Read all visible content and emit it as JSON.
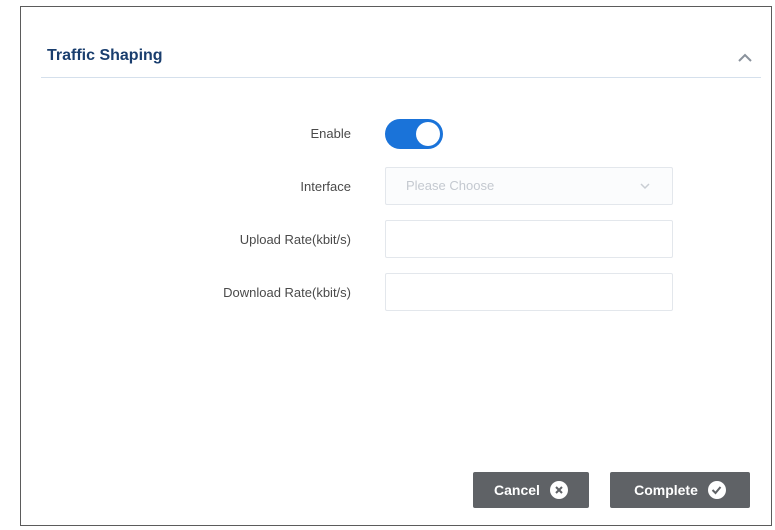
{
  "section": {
    "title": "Traffic Shaping",
    "collapse_icon": "chevron-up-icon"
  },
  "form": {
    "enable": {
      "label": "Enable",
      "value": true
    },
    "interface": {
      "label": "Interface",
      "placeholder": "Please Choose"
    },
    "upload_rate": {
      "label": "Upload Rate(kbit/s)",
      "value": ""
    },
    "download_rate": {
      "label": "Download Rate(kbit/s)",
      "value": ""
    }
  },
  "actions": {
    "cancel_label": "Cancel",
    "cancel_icon": "close-circle-icon",
    "complete_label": "Complete",
    "complete_icon": "check-circle-icon"
  },
  "colors": {
    "accent": "#1a73d9",
    "title": "#1a3e6e",
    "button_bg": "#5f6266"
  }
}
